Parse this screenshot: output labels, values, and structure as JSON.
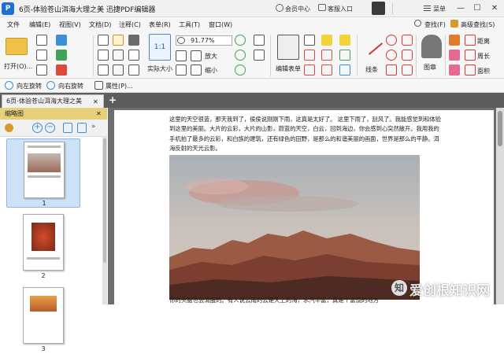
{
  "titlebar": {
    "logo": "P",
    "title": "6页-体验苍山洱海大理之美   迅捷PDF编辑器",
    "member_center": "会员中心",
    "service_entry": "客服入口",
    "menu": "菜单",
    "minimize": "—",
    "maximize": "☐",
    "close": "✕"
  },
  "menubar": {
    "items": [
      "文件",
      "编辑(E)",
      "视图(V)",
      "文档(D)",
      "注释(C)",
      "表单(R)",
      "工具(T)",
      "窗口(W)"
    ],
    "search": "查找(F)",
    "advanced_search": "高级查找(S)"
  },
  "ribbon": {
    "open": "打开(O)...",
    "zoom_value": "91.77%",
    "zoom_in": "放大",
    "zoom_out": "缩小",
    "actual_size": "实际大小",
    "edit_form": "编辑表单",
    "line_tool": "线条",
    "stamp": "图章",
    "distance": "距离",
    "perimeter": "周长",
    "area": "面积"
  },
  "quickbar": {
    "rotate_left": "向左旋转",
    "rotate_right": "向右旋转",
    "properties": "属性(P)..."
  },
  "tab": {
    "label": "6页-体验苍山洱海大理之美",
    "close": "✕",
    "new_tab": "+"
  },
  "sidepanel": {
    "title": "缩略图",
    "close": "✕",
    "pages": [
      "1",
      "2",
      "3"
    ]
  },
  "document": {
    "paragraph_1": "这里的天空很蓝，那天我到了，侯侯说刚刚下雨，这真是太好了。  这里下雨了，刮风了。我能感觉到和体验到这里的美丽。大片的云彩，大片的山影，蔚蓝的天空，白云，回到海边，你会感到心突然敞开。我用我的手机拍了最多的云彩，和白族的建筑，还有绿色的田野，是那么的和谐美丽的画面，世界是那么的平静。洱海反射的天光云影。",
    "paragraph_2": "你的头脑也会清醒的。有人说云南的云是天上的海，水汽丰富，真是个富饶的地方"
  },
  "watermark": {
    "logo": "知",
    "text": "爱创根知识网"
  },
  "colors": {
    "accent_blue": "#1f6fd6",
    "side_header": "#e6d07a",
    "doc_background": "#6d6d6d",
    "tab_bar": "#5d5d5d"
  }
}
